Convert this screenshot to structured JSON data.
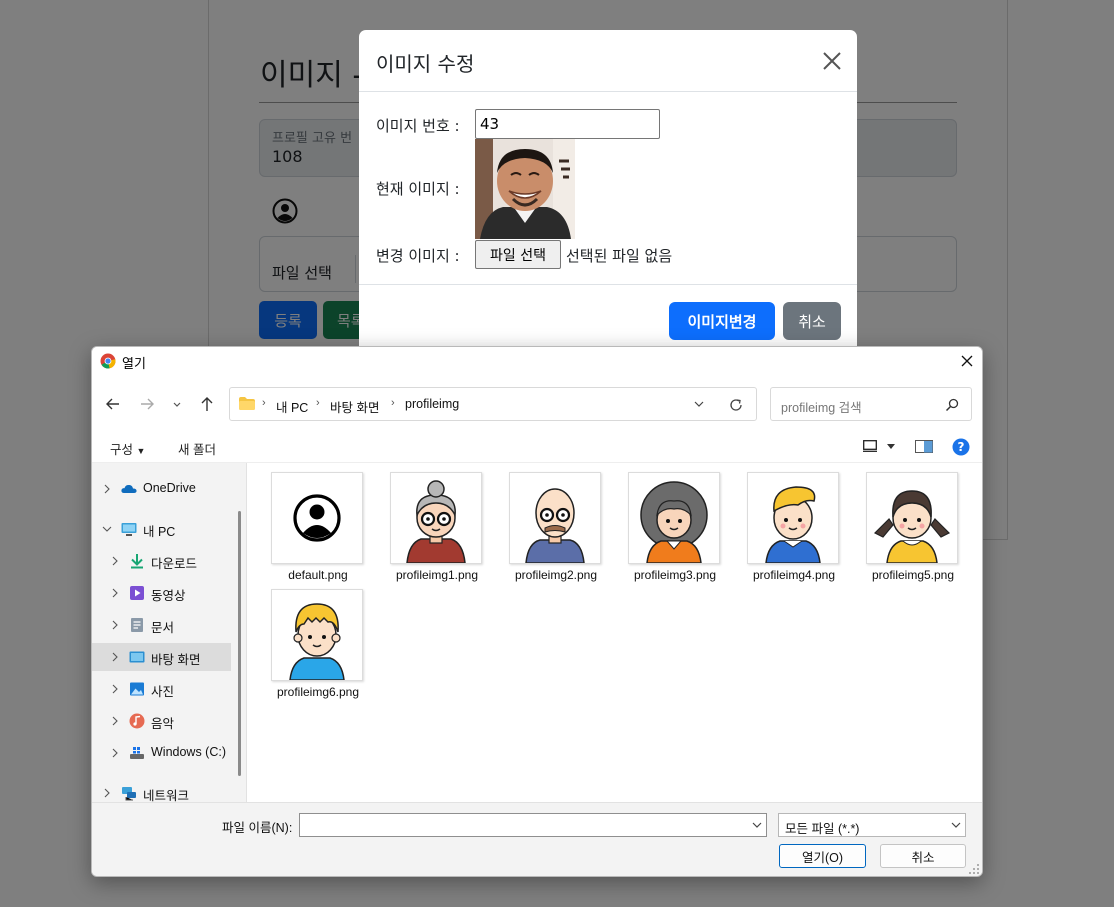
{
  "background_page": {
    "title": "이미지 -",
    "field_label": "프로필 고유 번",
    "field_value": "108",
    "file_button": "파일 선택",
    "register_button": "등록",
    "list_button": "목록"
  },
  "modal": {
    "title": "이미지 수정",
    "image_number_label": "이미지 번호 :",
    "image_number_value": "43",
    "current_image_label": "현재 이미지 :",
    "change_image_label": "변경 이미지 :",
    "file_choose_button": "파일 선택",
    "file_status": "선택된 파일 없음",
    "submit_button": "이미지변경",
    "cancel_button": "취소"
  },
  "file_dialog": {
    "title": "열기",
    "breadcrumb": [
      "내 PC",
      "바탕 화면",
      "profileimg"
    ],
    "search_placeholder": "profileimg 검색",
    "toolbar": {
      "organize": "구성",
      "new_folder": "새 폴더"
    },
    "sidebar": [
      {
        "label": "OneDrive",
        "icon": "cloud-icon"
      },
      {
        "label": "내 PC",
        "icon": "computer-icon"
      },
      {
        "label": "다운로드",
        "icon": "download-icon"
      },
      {
        "label": "동영상",
        "icon": "video-icon"
      },
      {
        "label": "문서",
        "icon": "document-icon"
      },
      {
        "label": "바탕 화면",
        "icon": "desktop-icon"
      },
      {
        "label": "사진",
        "icon": "pictures-icon"
      },
      {
        "label": "음악",
        "icon": "music-icon"
      },
      {
        "label": "Windows (C:)",
        "icon": "drive-icon"
      },
      {
        "label": "네트워크",
        "icon": "network-icon"
      }
    ],
    "files": [
      {
        "name": "default.png"
      },
      {
        "name": "profileimg1.png"
      },
      {
        "name": "profileimg2.png"
      },
      {
        "name": "profileimg3.png"
      },
      {
        "name": "profileimg4.png"
      },
      {
        "name": "profileimg5.png"
      },
      {
        "name": "profileimg6.png"
      }
    ],
    "filename_label": "파일 이름(N):",
    "filename_value": "",
    "filetype_value": "모든 파일 (*.*)",
    "open_button": "열기(O)",
    "cancel_button": "취소"
  }
}
